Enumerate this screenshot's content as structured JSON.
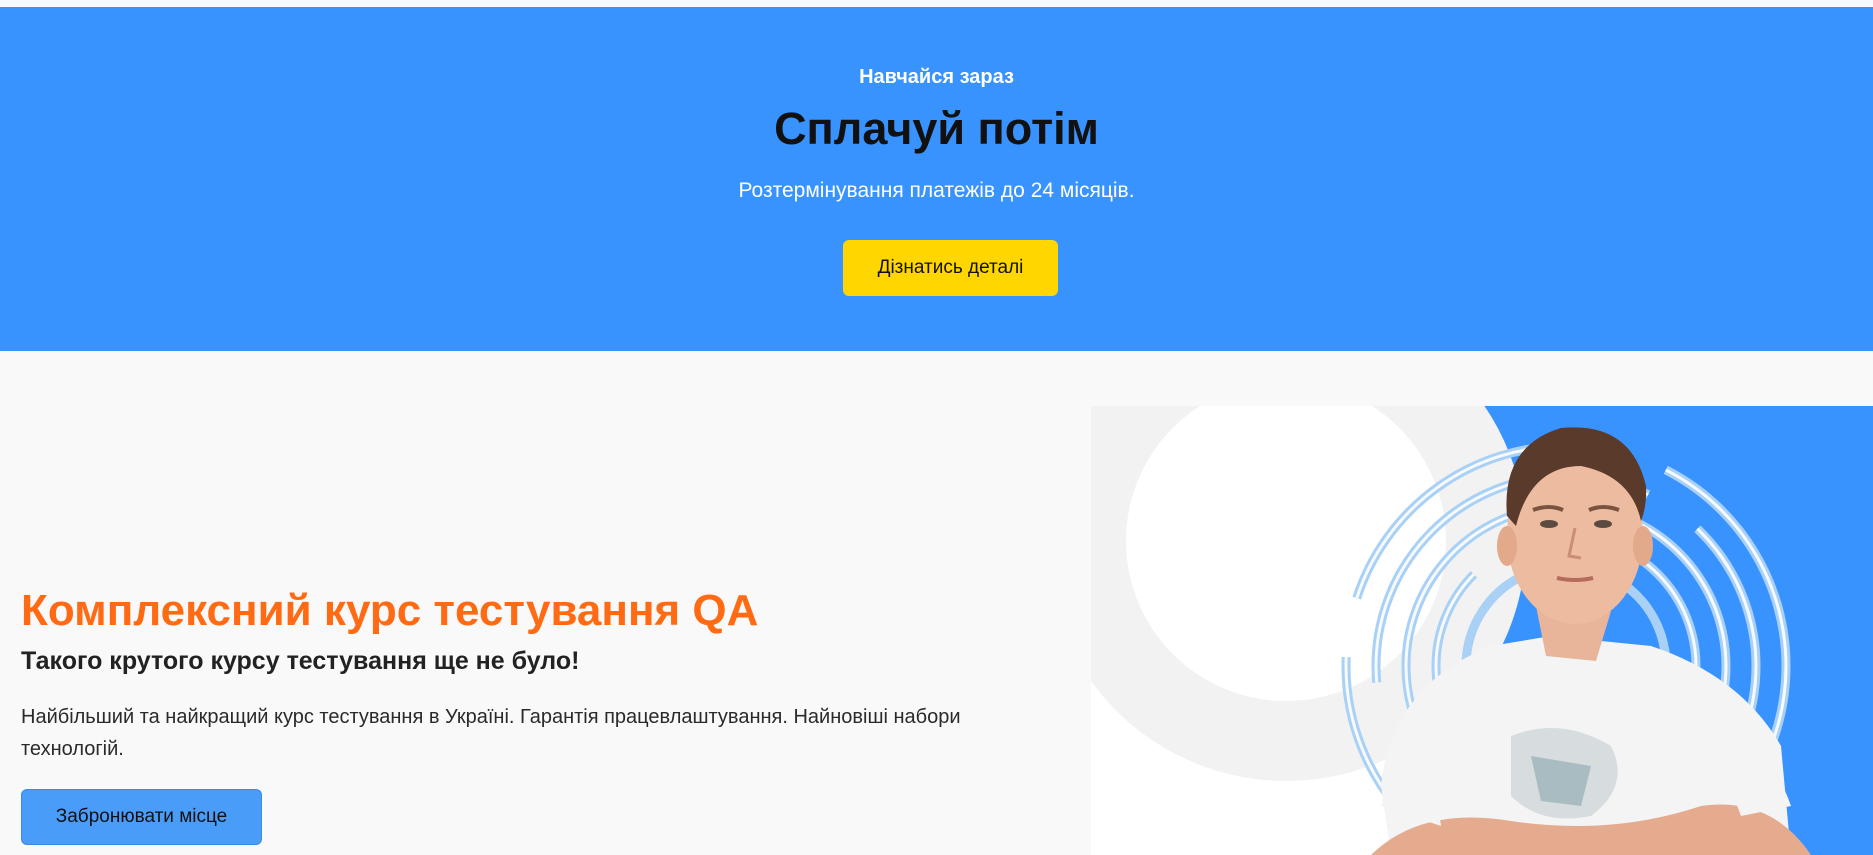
{
  "promo": {
    "kicker": "Навчайся зараз",
    "title": "Сплачуй потім",
    "text": "Розтермінування платежів до 24 місяців.",
    "button_label": "Дізнатись деталі",
    "background_color": "#3893ff",
    "button_color": "#ffd600"
  },
  "hero": {
    "title": "Комплексний курс тестування QA",
    "subtitle": "Такого крутого курсу тестування ще не було!",
    "description": "Найбільший та найкращий курс тестування в Україні. Гарантія працевлаштування. Найновіші набори технологій.",
    "button_label": "Забронювати місце",
    "title_color": "#ff6a13",
    "button_color": "#4a9cf9",
    "image": "instructor-photo"
  }
}
